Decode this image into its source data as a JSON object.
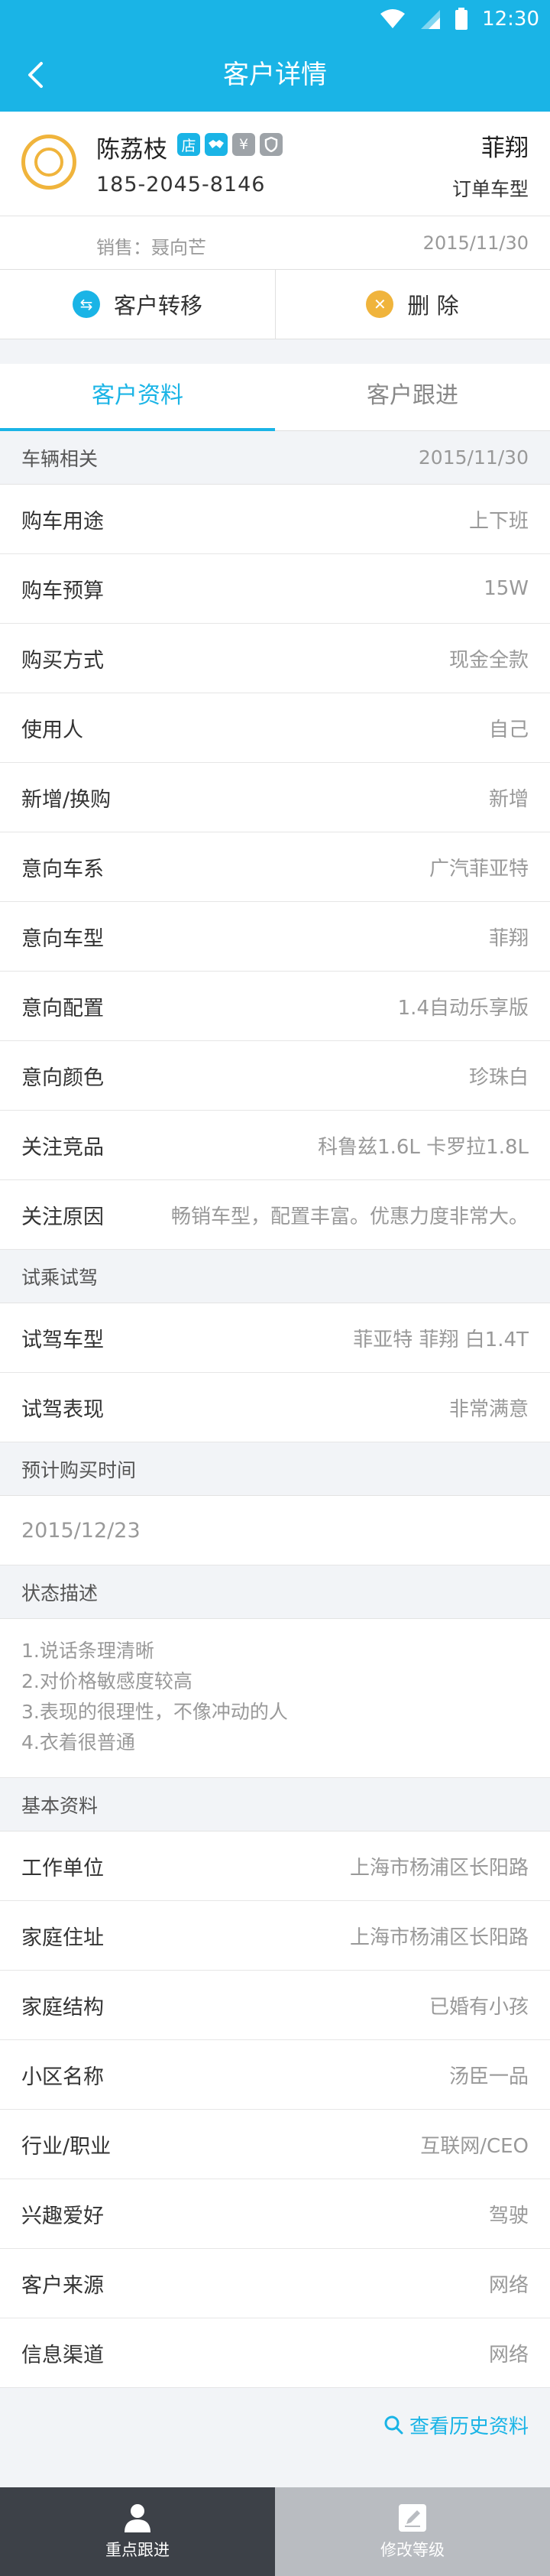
{
  "status_bar": {
    "time": "12:30",
    "icons": [
      "wifi-icon",
      "signal-icon",
      "battery-icon"
    ]
  },
  "nav": {
    "title": "客户详情",
    "back_icon": "back-arrow-icon"
  },
  "customer": {
    "name": "陈荔枝",
    "badges": [
      {
        "icon": "store-icon",
        "text": "店",
        "color": "#1ab4e6"
      },
      {
        "icon": "handshake-icon",
        "text": "",
        "color": "#1ab4e6"
      },
      {
        "icon": "yuan-icon",
        "text": "¥",
        "color": "#9ea3a8"
      },
      {
        "icon": "shield-icon",
        "text": "",
        "color": "#9ea3a8"
      }
    ],
    "phone": "185-2045-8146",
    "car": "菲翔",
    "car_type_label": "订单车型",
    "sales_label": "销售：聂向芒",
    "date": "2015/11/30"
  },
  "actions": {
    "transfer": "客户转移",
    "delete": "删 除"
  },
  "tabs": [
    {
      "label": "客户资料",
      "active": true
    },
    {
      "label": "客户跟进",
      "active": false
    }
  ],
  "vehicle": {
    "title": "车辆相关",
    "date": "2015/11/30",
    "rows": [
      {
        "label": "购车用途",
        "value": "上下班"
      },
      {
        "label": "购车预算",
        "value": "15W"
      },
      {
        "label": "购买方式",
        "value": "现金全款"
      },
      {
        "label": "使用人",
        "value": "自己"
      },
      {
        "label": "新增/换购",
        "value": "新增"
      },
      {
        "label": "意向车系",
        "value": "广汽菲亚特"
      },
      {
        "label": "意向车型",
        "value": "菲翔"
      },
      {
        "label": "意向配置",
        "value": "1.4自动乐享版"
      },
      {
        "label": "意向颜色",
        "value": "珍珠白"
      },
      {
        "label": "关注竞品",
        "value": "科鲁兹1.6L  卡罗拉1.8L"
      },
      {
        "label": "关注原因",
        "value": "畅销车型，配置丰富。优惠力度非常大。"
      }
    ]
  },
  "test_drive": {
    "title": "试乘试驾",
    "rows": [
      {
        "label": "试驾车型",
        "value": "菲亚特 菲翔 白1.4T"
      },
      {
        "label": "试驾表现",
        "value": "非常满意"
      }
    ]
  },
  "purchase_time": {
    "title": "预计购买时间",
    "value": "2015/12/23"
  },
  "status_desc": {
    "title": "状态描述",
    "lines": [
      "1.说话条理清晰",
      "2.对价格敏感度较高",
      "3.表现的很理性，不像冲动的人",
      "4.衣着很普通"
    ]
  },
  "basic": {
    "title": "基本资料",
    "rows": [
      {
        "label": "工作单位",
        "value": "上海市杨浦区长阳路"
      },
      {
        "label": "家庭住址",
        "value": "上海市杨浦区长阳路"
      },
      {
        "label": "家庭结构",
        "value": "已婚有小孩"
      },
      {
        "label": "小区名称",
        "value": "汤臣一品"
      },
      {
        "label": "行业/职业",
        "value": "互联网/CEO"
      },
      {
        "label": "兴趣爱好",
        "value": "驾驶"
      },
      {
        "label": "客户来源",
        "value": "网络"
      },
      {
        "label": "信息渠道",
        "value": "网络"
      }
    ]
  },
  "history_link": "查看历史资料",
  "bottom_bar": [
    {
      "label": "重点跟进",
      "icon": "person-icon",
      "color": "#3d4148"
    },
    {
      "label": "修改等级",
      "icon": "edit-icon",
      "color": "#b9bcc1"
    }
  ]
}
